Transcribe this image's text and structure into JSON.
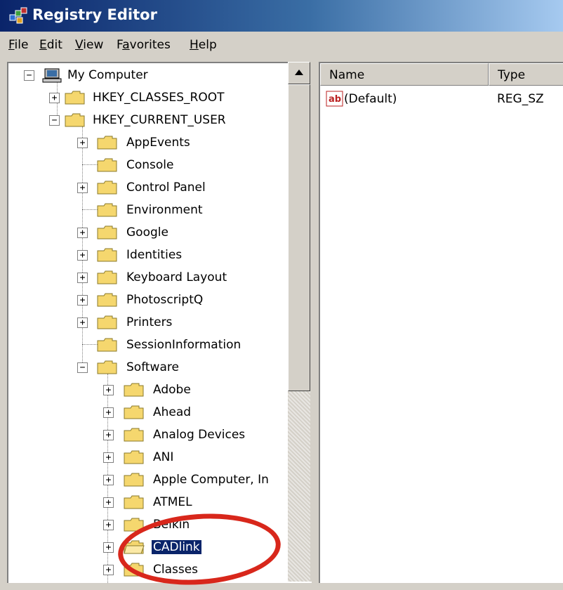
{
  "window": {
    "title": "Registry Editor"
  },
  "menu": [
    {
      "label": "File",
      "accel": "F",
      "rest": "ile"
    },
    {
      "label": "Edit",
      "accel": "E",
      "rest": "dit"
    },
    {
      "label": "View",
      "accel": "V",
      "rest": "iew"
    },
    {
      "label": "Favorites",
      "accel": "a",
      "pre": "F",
      "rest": "vorites"
    },
    {
      "label": "Help",
      "accel": "H",
      "rest": "elp"
    }
  ],
  "tree": {
    "root": "My Computer",
    "hkcr": "HKEY_CLASSES_ROOT",
    "hkcu": "HKEY_CURRENT_USER",
    "hkcu_children": [
      "AppEvents",
      "Console",
      "Control Panel",
      "Environment",
      "Google",
      "Identities",
      "Keyboard Layout",
      "PhotoscriptQ",
      "Printers",
      "SessionInformation",
      "Software"
    ],
    "software_children": [
      "Adobe",
      "Ahead",
      "Analog Devices",
      "ANI",
      "Apple Computer, In",
      "ATMEL",
      "Belkin",
      "CADlink",
      "Classes"
    ],
    "selected": "CADlink"
  },
  "list": {
    "columns": [
      "Name",
      "Type"
    ],
    "rows": [
      {
        "name": "(Default)",
        "type": "REG_SZ",
        "icon": "ab-string-icon"
      }
    ]
  },
  "annotation": {
    "color": "#d8271b",
    "shape": "ellipse",
    "target": "CADlink"
  }
}
